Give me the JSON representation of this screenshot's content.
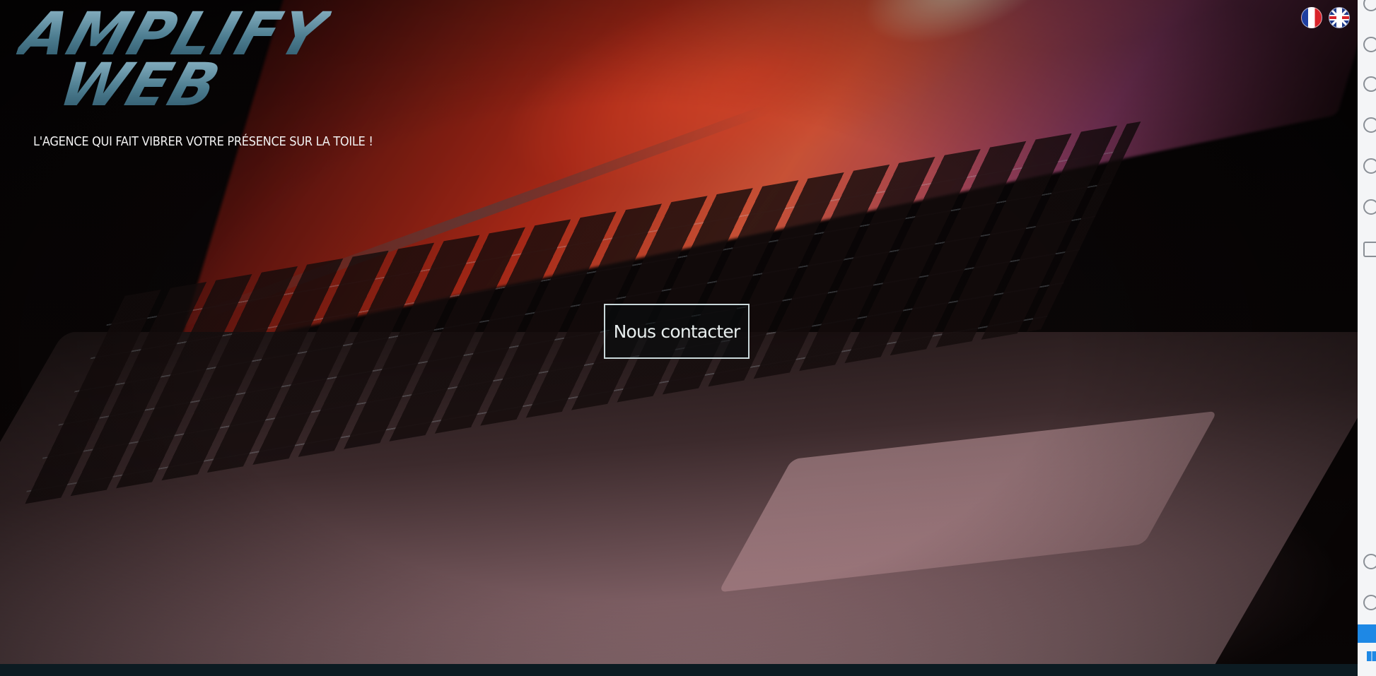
{
  "logo": {
    "line1": "AMPLIFY",
    "line2": "WEB"
  },
  "tagline": "L'AGENCE QUI FAIT VIBRER VOTRE PRÉSENCE SUR LA TOILE !",
  "cta": {
    "label": "Nous contacter"
  },
  "languages": [
    {
      "code": "fr",
      "icon": "france-flag-icon"
    },
    {
      "code": "en",
      "icon": "uk-flag-icon"
    }
  ],
  "sidebar": {
    "icons": [
      "settings-icon",
      "git-icon",
      "info-icon",
      "info-icon",
      "lightning-icon",
      "javascript-icon",
      "layout-icon",
      "account-icon",
      "gear-icon",
      "close-icon",
      "windows-icon"
    ]
  },
  "colors": {
    "logo": "#4d7d90",
    "button_border": "#c9d8da",
    "accent": "#1e88e5"
  }
}
